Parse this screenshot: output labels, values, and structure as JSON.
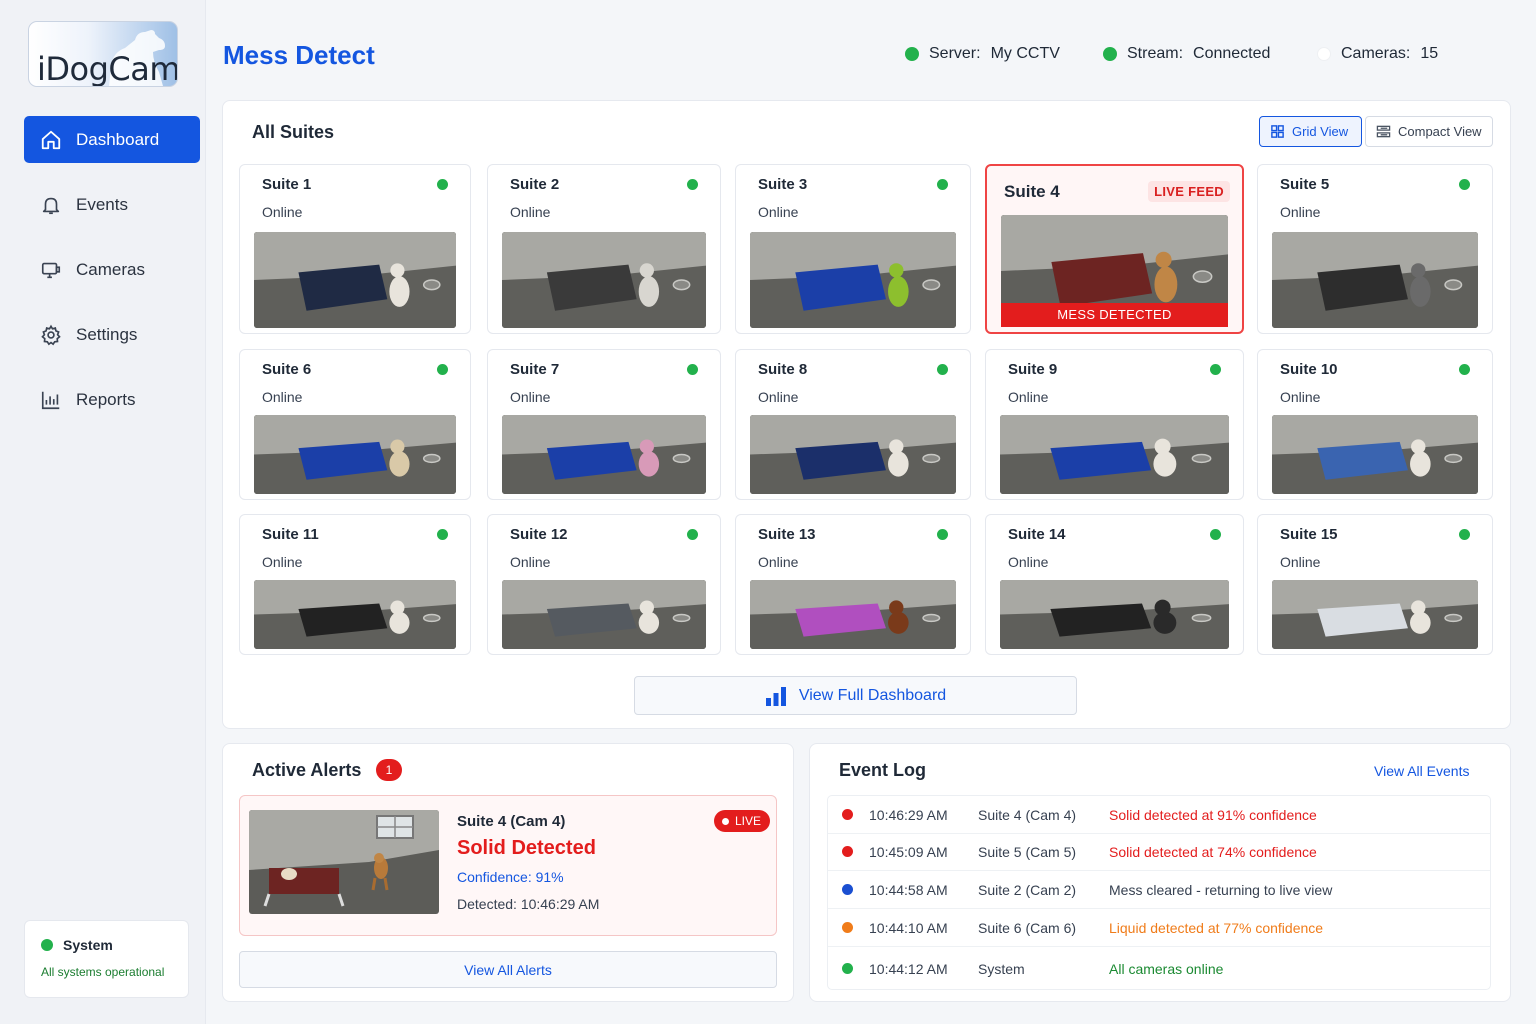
{
  "brand": {
    "logo_text": "iDogCam"
  },
  "sidebar": {
    "items": [
      {
        "label": "Dashboard",
        "icon": "home-icon",
        "active": true
      },
      {
        "label": "Events",
        "icon": "bell-icon",
        "active": false
      },
      {
        "label": "Cameras",
        "icon": "camera-icon",
        "active": false
      },
      {
        "label": "Settings",
        "icon": "gear-icon",
        "active": false
      },
      {
        "label": "Reports",
        "icon": "chart-icon",
        "active": false
      }
    ],
    "system": {
      "title": "System",
      "status": "All systems operational"
    }
  },
  "header": {
    "title": "Mess Detect",
    "server": {
      "label": "Server:",
      "value": "My CCTV"
    },
    "stream": {
      "label": "Stream:",
      "value": "Connected"
    },
    "cameras": {
      "label": "Cameras:",
      "value": "15"
    }
  },
  "suites_panel": {
    "title": "All Suites",
    "grid_view": "Grid View",
    "compact_view": "Compact View",
    "full_dashboard": "View Full Dashboard",
    "suites": [
      {
        "name": "Suite 1",
        "status": "Online"
      },
      {
        "name": "Suite 2",
        "status": "Online"
      },
      {
        "name": "Suite 3",
        "status": "Online"
      },
      {
        "name": "Suite 4",
        "status": "",
        "badge": "LIVE FEED",
        "banner": "MESS DETECTED"
      },
      {
        "name": "Suite 5",
        "status": "Online"
      },
      {
        "name": "Suite 6",
        "status": "Online"
      },
      {
        "name": "Suite 7",
        "status": "Online"
      },
      {
        "name": "Suite 8",
        "status": "Online"
      },
      {
        "name": "Suite 9",
        "status": "Online"
      },
      {
        "name": "Suite 10",
        "status": "Online"
      },
      {
        "name": "Suite 11",
        "status": "Online"
      },
      {
        "name": "Suite 12",
        "status": "Online"
      },
      {
        "name": "Suite 13",
        "status": "Online"
      },
      {
        "name": "Suite 14",
        "status": "Online"
      },
      {
        "name": "Suite 15",
        "status": "Online"
      }
    ]
  },
  "alerts": {
    "title": "Active Alerts",
    "count": "1",
    "item": {
      "camera": "Suite 4 (Cam 4)",
      "type": "Solid Detected",
      "confidence": "Confidence: 91%",
      "detected": "Detected: 10:46:29 AM",
      "badge": "LIVE"
    },
    "view_all": "View All Alerts"
  },
  "event_log": {
    "title": "Event Log",
    "view_all": "View All Events",
    "rows": [
      {
        "time": "10:46:29 AM",
        "source": "Suite 4 (Cam 4)",
        "message": "Solid detected at 91% confidence",
        "color": "#e31d1d"
      },
      {
        "time": "10:45:09 AM",
        "source": "Suite 5 (Cam 5)",
        "message": "Solid detected at 74% confidence",
        "color": "#e31d1d"
      },
      {
        "time": "10:44:58 AM",
        "source": "Suite 2 (Cam 2)",
        "message": "Mess cleared - returning to live view",
        "color": "#1a4fd1"
      },
      {
        "time": "10:44:10 AM",
        "source": "Suite 6 (Cam 6)",
        "message": "Liquid detected at 77% confidence",
        "color": "#f07c1a"
      },
      {
        "time": "10:44:12 AM",
        "source": "System",
        "message": "All cameras online",
        "color": "#22b14c"
      }
    ]
  },
  "colors": {
    "accent": "#1456e0",
    "alert": "#e31d1d",
    "online": "#22b14c",
    "warning": "#f07c1a"
  }
}
